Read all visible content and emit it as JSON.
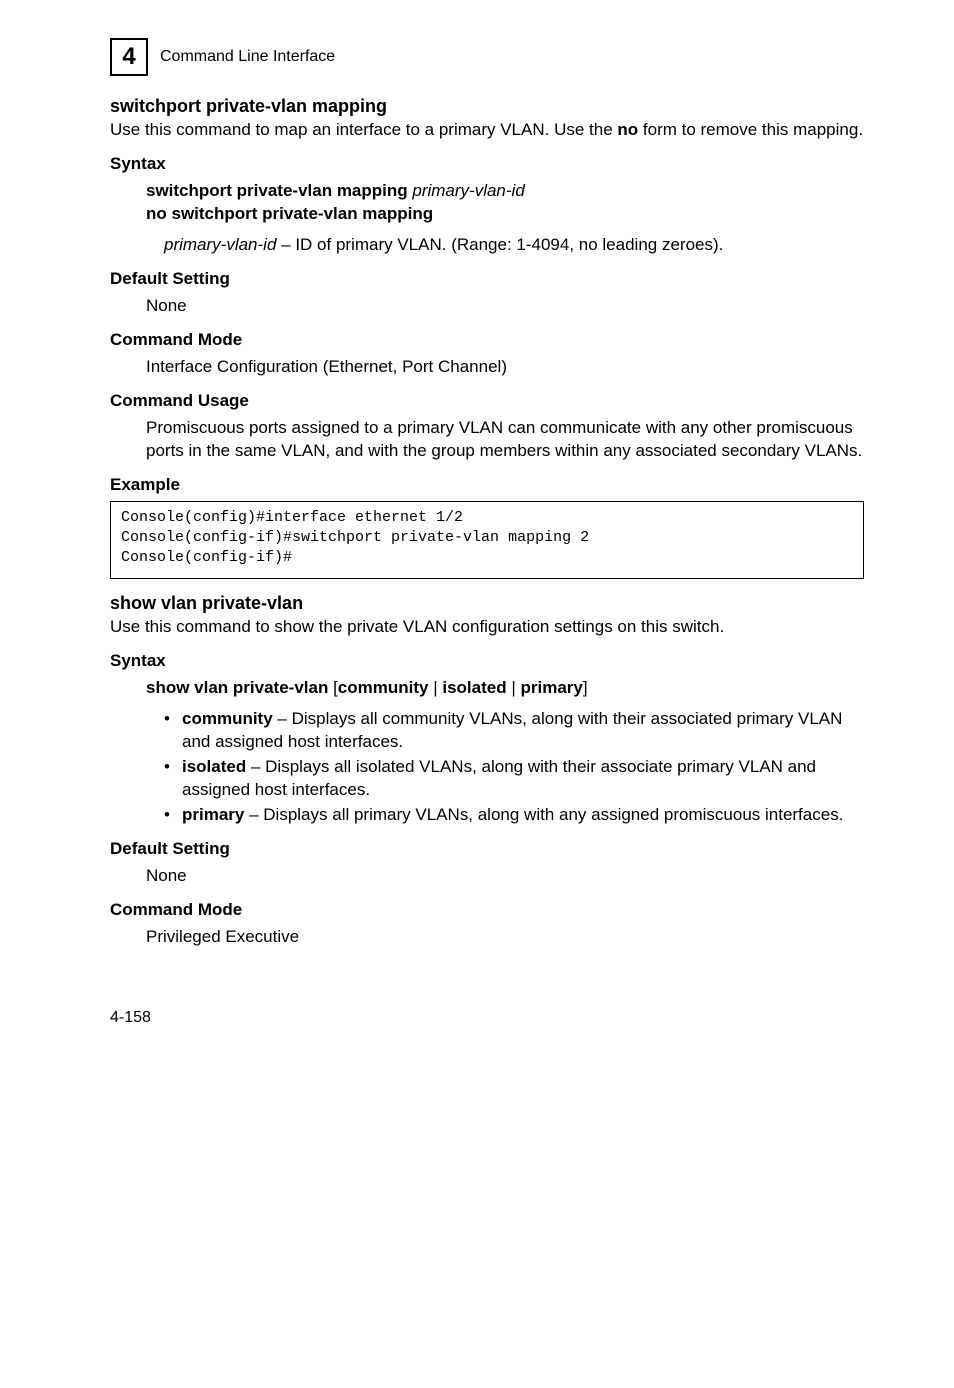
{
  "header": {
    "chapter_num": "4",
    "chapter_title": "Command Line Interface"
  },
  "section1": {
    "title": "switchport private-vlan mapping",
    "desc_pre": "Use this command to map an interface to a primary VLAN. Use the ",
    "desc_bold": "no",
    "desc_post": " form to remove this mapping.",
    "syntax_label": "Syntax",
    "syntax_line1_bold": "switchport private-vlan mapping ",
    "syntax_line1_italic": "primary-vlan-id",
    "syntax_line2": "no switchport private-vlan mapping",
    "param_italic": "primary-vlan-id",
    "param_rest": " – ID of primary VLAN. (Range: 1-4094, no leading zeroes).",
    "default_label": "Default Setting",
    "default_value": "None",
    "mode_label": "Command Mode",
    "mode_value": "Interface Configuration (Ethernet, Port Channel)",
    "usage_label": "Command Usage",
    "usage_text": "Promiscuous ports assigned to a primary VLAN can communicate with any other promiscuous ports in the same VLAN, and with the group members within any associated secondary VLANs.",
    "example_label": "Example",
    "code": "Console(config)#interface ethernet 1/2\nConsole(config-if)#switchport private-vlan mapping 2\nConsole(config-if)#"
  },
  "section2": {
    "title": "show vlan private-vlan",
    "desc": "Use this command to show the private VLAN configuration settings on this switch.",
    "syntax_label": "Syntax",
    "syntax_bold1": "show vlan private-vlan",
    "syntax_sep1": " [",
    "syntax_bold2": "community",
    "syntax_sep2": " | ",
    "syntax_bold3": "isolated",
    "syntax_sep3": " | ",
    "syntax_bold4": "primary",
    "syntax_sep4": "]",
    "items": [
      {
        "term": "community",
        "rest": " – Displays all community VLANs, along with their associated primary VLAN and assigned host interfaces."
      },
      {
        "term": "isolated",
        "rest": " – Displays all isolated VLANs, along with their associate primary VLAN and assigned host interfaces."
      },
      {
        "term": "primary",
        "rest": " – Displays all primary VLANs, along with any assigned promiscuous interfaces."
      }
    ],
    "default_label": "Default Setting",
    "default_value": "None",
    "mode_label": "Command Mode",
    "mode_value": "Privileged Executive"
  },
  "footer": {
    "pagenum": "4-158"
  }
}
